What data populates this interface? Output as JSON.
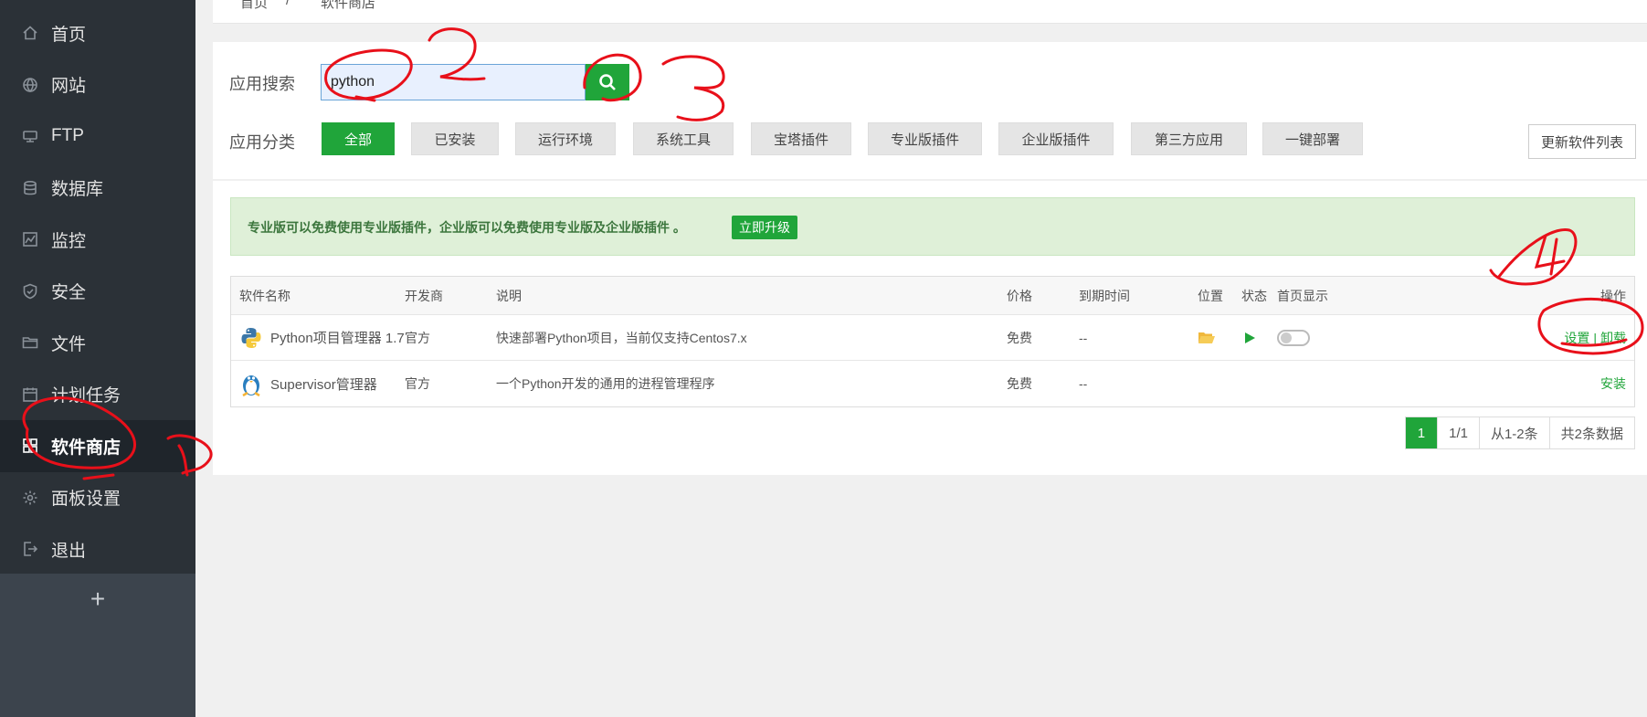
{
  "sidebar": {
    "items": [
      {
        "label": "首页",
        "icon": "home-icon"
      },
      {
        "label": "网站",
        "icon": "globe-icon"
      },
      {
        "label": "FTP",
        "icon": "ftp-icon"
      },
      {
        "label": "数据库",
        "icon": "database-icon"
      },
      {
        "label": "监控",
        "icon": "monitor-icon"
      },
      {
        "label": "安全",
        "icon": "shield-icon"
      },
      {
        "label": "文件",
        "icon": "folder-icon"
      },
      {
        "label": "计划任务",
        "icon": "calendar-icon"
      },
      {
        "label": "软件商店",
        "icon": "apps-icon",
        "active": true
      },
      {
        "label": "面板设置",
        "icon": "gear-icon"
      },
      {
        "label": "退出",
        "icon": "logout-icon"
      }
    ],
    "add_label": "+"
  },
  "breadcrumb": {
    "home": "首页",
    "sep": "/",
    "current": "软件商店"
  },
  "filter": {
    "search_label": "应用搜索",
    "search_value": "python",
    "category_label": "应用分类",
    "categories": [
      "全部",
      "已安装",
      "运行环境",
      "系统工具",
      "宝塔插件",
      "专业版插件",
      "企业版插件",
      "第三方应用",
      "一键部署"
    ],
    "active_category": "全部",
    "refresh_label": "更新软件列表"
  },
  "notice": {
    "text": "专业版可以免费使用专业版插件，企业版可以免费使用专业版及企业版插件 。",
    "upgrade_label": "立即升级"
  },
  "table": {
    "headers": {
      "name": "软件名称",
      "dev": "开发商",
      "desc": "说明",
      "price": "价格",
      "expire": "到期时间",
      "location": "位置",
      "status": "状态",
      "home": "首页显示",
      "ops": "操作"
    },
    "rows": [
      {
        "name": "Python项目管理器 1.7",
        "icon": "python-logo-icon",
        "dev": "官方",
        "desc": "快速部署Python项目，当前仅支持Centos7.x",
        "price": "免费",
        "expire": "--",
        "op1": "设置",
        "sep": "|",
        "op2": "卸载"
      },
      {
        "name": "Supervisor管理器",
        "icon": "tux-icon",
        "dev": "官方",
        "desc": "一个Python开发的通用的进程管理程序",
        "price": "免费",
        "expire": "--",
        "op1": "安装"
      }
    ]
  },
  "pagination": {
    "current": "1",
    "pages": "1/1",
    "range": "从1-2条",
    "total": "共2条数据"
  },
  "colors": {
    "accent": "#20a53a",
    "sidebar": "#2b3137",
    "annotation": "#e8101a"
  }
}
